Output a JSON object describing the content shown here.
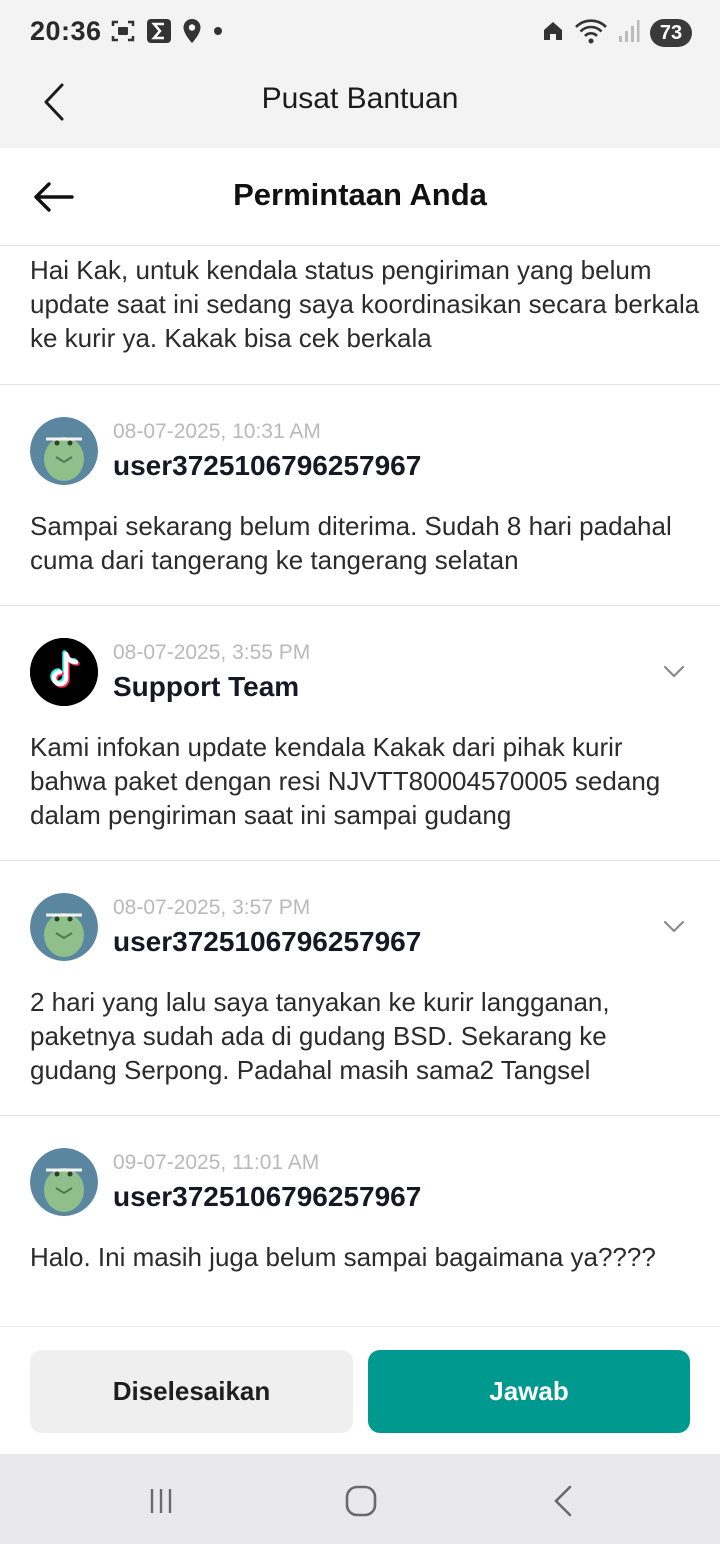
{
  "status_bar": {
    "time": "20:36",
    "battery": "73",
    "left_icons": [
      "screenshot-icon",
      "sigma-icon",
      "location-icon",
      "dot-icon"
    ],
    "right_icons": [
      "home-icon",
      "wifi-icon",
      "signal-icon"
    ]
  },
  "outer_header": {
    "title": "Pusat Bantuan"
  },
  "inner_header": {
    "title": "Permintaan Anda"
  },
  "messages": [
    {
      "text": "Hai Kak, untuk kendala status pengiriman yang belum update saat ini sedang saya koordinasikan secara berkala ke kurir ya. Kakak bisa cek berkala"
    },
    {
      "time": "08-07-2025, 10:31 AM",
      "author": "user3725106796257967",
      "avatar": "user-avatar",
      "text": "Sampai sekarang belum diterima. Sudah 8 hari padahal cuma dari tangerang ke tangerang selatan"
    },
    {
      "time": "08-07-2025, 3:55 PM",
      "author": "Support Team",
      "avatar": "tiktok-logo",
      "text": "Kami infokan update kendala Kakak dari pihak kurir bahwa paket dengan resi NJVTT80004570005 sedang dalam pengiriman saat ini sampai gudang"
    },
    {
      "time": "08-07-2025, 3:57 PM",
      "author": "user3725106796257967",
      "avatar": "user-avatar",
      "text": "2 hari yang lalu saya tanyakan ke kurir langganan, paketnya sudah ada di gudang BSD. Sekarang ke gudang Serpong. Padahal masih sama2 Tangsel"
    },
    {
      "time": "09-07-2025, 11:01 AM",
      "author": "user3725106796257967",
      "avatar": "user-avatar",
      "text": "Halo. Ini masih juga belum sampai bagaimana ya????"
    }
  ],
  "actions": {
    "resolve_label": "Diselesaikan",
    "reply_label": "Jawab"
  },
  "colors": {
    "accent": "#009990",
    "header_bg": "#f3f3f3",
    "timestamp": "#b9b9b9"
  },
  "nav_bar": {
    "icons": [
      "recent-apps-icon",
      "home-icon",
      "back-icon"
    ]
  }
}
